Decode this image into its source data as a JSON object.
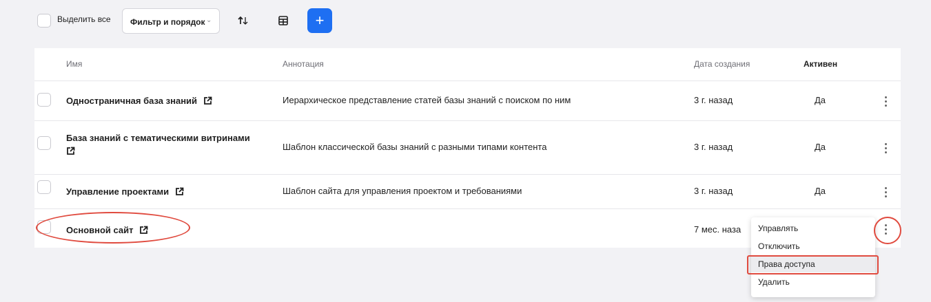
{
  "toolbar": {
    "select_all_label": "Выделить все",
    "filter_label": "Фильтр и порядок",
    "add_label": "+"
  },
  "table": {
    "columns": {
      "name": "Имя",
      "annotation": "Аннотация",
      "created": "Дата создания",
      "active": "Активен"
    },
    "rows": [
      {
        "name": "Одностраничная база знаний",
        "annotation": "Иерархическое представление статей базы знаний с поиском по ним",
        "created": "3 г. назад",
        "active": "Да"
      },
      {
        "name_line1": "База знаний с тематическими витринами",
        "annotation": "Шаблон классической базы знаний с разными типами контента",
        "created": "3 г. назад",
        "active": "Да"
      },
      {
        "name": "Управление проектами",
        "annotation": "Шаблон сайта для управления проектом и требованиями",
        "created": "3 г. назад",
        "active": "Да"
      },
      {
        "name": "Основной сайт",
        "annotation": "",
        "created": "7 мес. наза",
        "active": ""
      }
    ]
  },
  "context_menu": {
    "items": [
      "Управлять",
      "Отключить",
      "Права доступа",
      "Удалить"
    ]
  },
  "colors": {
    "accent": "#1e6ff2",
    "annotation_red": "#e04a3e"
  }
}
